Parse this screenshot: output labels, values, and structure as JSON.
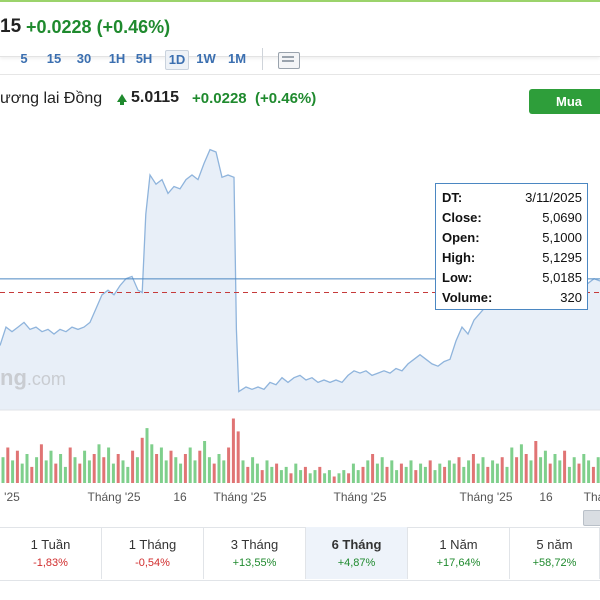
{
  "header": {
    "price_fragment": "15",
    "change": "+0.0228 (+0.46%)"
  },
  "toolbar": {
    "timeframes": [
      "5",
      "15",
      "30",
      "1H",
      "5H",
      "1D",
      "1W",
      "1M"
    ],
    "active": "1D"
  },
  "chart_header": {
    "name": "ương lai Đồng",
    "price": "5.0115",
    "change": "+0.0228",
    "change_pct": "(+0.46%)",
    "buy_label": "Mua"
  },
  "tooltip": {
    "rows": [
      {
        "key": "DT:",
        "value": "3/11/2025"
      },
      {
        "key": "Close:",
        "value": "5,0690"
      },
      {
        "key": "Open:",
        "value": "5,1000"
      },
      {
        "key": "High:",
        "value": "5,1295"
      },
      {
        "key": "Low:",
        "value": "5,0185"
      },
      {
        "key": "Volume:",
        "value": "320"
      }
    ]
  },
  "watermark": {
    "text": "ng",
    "suffix": ".com"
  },
  "colors": {
    "line": "#8fb4dc",
    "area": "#e8eff8",
    "up_volume": "#7fcf8c",
    "down_volume": "#e07474",
    "accent_green": "#1f8a2e",
    "negative_red": "#d12d2d",
    "crosshair": "#4b87c2",
    "reference_dashed": "#c63a3a"
  },
  "chart_data": {
    "type": "area",
    "title": "",
    "xlabel": "",
    "ylabel": "",
    "x_tick_labels": [
      "'25",
      "Tháng '25",
      "16",
      "Tháng '25",
      "Tháng '25",
      "Tháng '25",
      "16",
      "Thá"
    ],
    "x_tick_positions": [
      0.02,
      0.19,
      0.3,
      0.4,
      0.6,
      0.81,
      0.91,
      0.99
    ],
    "price_series": [
      {
        "x": 0.0,
        "y": 4.78
      },
      {
        "x": 0.01,
        "y": 4.86
      },
      {
        "x": 0.02,
        "y": 4.84
      },
      {
        "x": 0.03,
        "y": 4.86
      },
      {
        "x": 0.04,
        "y": 4.88
      },
      {
        "x": 0.05,
        "y": 4.85
      },
      {
        "x": 0.06,
        "y": 4.86
      },
      {
        "x": 0.07,
        "y": 4.84
      },
      {
        "x": 0.08,
        "y": 4.85
      },
      {
        "x": 0.09,
        "y": 4.83
      },
      {
        "x": 0.1,
        "y": 4.85
      },
      {
        "x": 0.11,
        "y": 4.84
      },
      {
        "x": 0.12,
        "y": 4.86
      },
      {
        "x": 0.13,
        "y": 4.85
      },
      {
        "x": 0.14,
        "y": 4.86
      },
      {
        "x": 0.15,
        "y": 4.88
      },
      {
        "x": 0.16,
        "y": 4.94
      },
      {
        "x": 0.17,
        "y": 5.0
      },
      {
        "x": 0.18,
        "y": 5.02
      },
      {
        "x": 0.19,
        "y": 5.0
      },
      {
        "x": 0.2,
        "y": 5.04
      },
      {
        "x": 0.21,
        "y": 5.07
      },
      {
        "x": 0.22,
        "y": 5.08
      },
      {
        "x": 0.23,
        "y": 5.02
      },
      {
        "x": 0.237,
        "y": 5.01
      },
      {
        "x": 0.243,
        "y": 5.35
      },
      {
        "x": 0.25,
        "y": 5.52
      },
      {
        "x": 0.26,
        "y": 5.48
      },
      {
        "x": 0.27,
        "y": 5.5
      },
      {
        "x": 0.28,
        "y": 5.44
      },
      {
        "x": 0.29,
        "y": 5.47
      },
      {
        "x": 0.3,
        "y": 5.46
      },
      {
        "x": 0.31,
        "y": 5.5
      },
      {
        "x": 0.32,
        "y": 5.52
      },
      {
        "x": 0.33,
        "y": 5.5
      },
      {
        "x": 0.34,
        "y": 5.57
      },
      {
        "x": 0.35,
        "y": 5.63
      },
      {
        "x": 0.36,
        "y": 5.62
      },
      {
        "x": 0.37,
        "y": 5.51
      },
      {
        "x": 0.38,
        "y": 5.52
      },
      {
        "x": 0.39,
        "y": 5.51
      },
      {
        "x": 0.394,
        "y": 4.85
      },
      {
        "x": 0.398,
        "y": 4.58
      },
      {
        "x": 0.41,
        "y": 4.6
      },
      {
        "x": 0.42,
        "y": 4.59
      },
      {
        "x": 0.43,
        "y": 4.6
      },
      {
        "x": 0.44,
        "y": 4.59
      },
      {
        "x": 0.45,
        "y": 4.62
      },
      {
        "x": 0.46,
        "y": 4.61
      },
      {
        "x": 0.47,
        "y": 4.64
      },
      {
        "x": 0.48,
        "y": 4.62
      },
      {
        "x": 0.49,
        "y": 4.64
      },
      {
        "x": 0.5,
        "y": 4.65
      },
      {
        "x": 0.51,
        "y": 4.63
      },
      {
        "x": 0.52,
        "y": 4.64
      },
      {
        "x": 0.53,
        "y": 4.62
      },
      {
        "x": 0.54,
        "y": 4.63
      },
      {
        "x": 0.55,
        "y": 4.62
      },
      {
        "x": 0.56,
        "y": 4.63
      },
      {
        "x": 0.57,
        "y": 4.62
      },
      {
        "x": 0.58,
        "y": 4.65
      },
      {
        "x": 0.59,
        "y": 4.67
      },
      {
        "x": 0.6,
        "y": 4.66
      },
      {
        "x": 0.61,
        "y": 4.67
      },
      {
        "x": 0.62,
        "y": 4.65
      },
      {
        "x": 0.63,
        "y": 4.66
      },
      {
        "x": 0.64,
        "y": 4.67
      },
      {
        "x": 0.65,
        "y": 4.66
      },
      {
        "x": 0.66,
        "y": 4.68
      },
      {
        "x": 0.67,
        "y": 4.67
      },
      {
        "x": 0.68,
        "y": 4.7
      },
      {
        "x": 0.69,
        "y": 4.72
      },
      {
        "x": 0.7,
        "y": 4.74
      },
      {
        "x": 0.71,
        "y": 4.72
      },
      {
        "x": 0.72,
        "y": 4.7
      },
      {
        "x": 0.73,
        "y": 4.69
      },
      {
        "x": 0.74,
        "y": 4.71
      },
      {
        "x": 0.75,
        "y": 4.72
      },
      {
        "x": 0.76,
        "y": 4.8
      },
      {
        "x": 0.77,
        "y": 4.86
      },
      {
        "x": 0.78,
        "y": 4.83
      },
      {
        "x": 0.79,
        "y": 4.89
      },
      {
        "x": 0.8,
        "y": 4.92
      },
      {
        "x": 0.81,
        "y": 4.95
      },
      {
        "x": 0.82,
        "y": 4.98
      },
      {
        "x": 0.83,
        "y": 5.0
      },
      {
        "x": 0.84,
        "y": 5.01
      },
      {
        "x": 0.85,
        "y": 4.99
      },
      {
        "x": 0.86,
        "y": 5.02
      },
      {
        "x": 0.87,
        "y": 5.01
      },
      {
        "x": 0.88,
        "y": 5.03
      },
      {
        "x": 0.89,
        "y": 5.05
      },
      {
        "x": 0.9,
        "y": 5.04
      },
      {
        "x": 0.91,
        "y": 5.06
      },
      {
        "x": 0.92,
        "y": 5.05
      },
      {
        "x": 0.93,
        "y": 5.07
      },
      {
        "x": 0.94,
        "y": 5.06
      },
      {
        "x": 0.95,
        "y": 5.05
      },
      {
        "x": 0.96,
        "y": 5.04
      },
      {
        "x": 0.97,
        "y": 5.03
      },
      {
        "x": 0.98,
        "y": 5.05
      },
      {
        "x": 0.99,
        "y": 5.07
      },
      {
        "x": 1.0,
        "y": 5.06
      }
    ],
    "price_range": [
      4.5,
      5.75
    ],
    "crosshair_price": 5.069,
    "reference_price": 5.01,
    "volume_series": [
      {
        "x": 0.005,
        "v": 40,
        "up": true
      },
      {
        "x": 0.013,
        "v": 55,
        "up": false
      },
      {
        "x": 0.021,
        "v": 35,
        "up": true
      },
      {
        "x": 0.029,
        "v": 50,
        "up": false
      },
      {
        "x": 0.037,
        "v": 30,
        "up": true
      },
      {
        "x": 0.045,
        "v": 45,
        "up": true
      },
      {
        "x": 0.053,
        "v": 25,
        "up": false
      },
      {
        "x": 0.061,
        "v": 40,
        "up": true
      },
      {
        "x": 0.069,
        "v": 60,
        "up": false
      },
      {
        "x": 0.077,
        "v": 35,
        "up": true
      },
      {
        "x": 0.085,
        "v": 50,
        "up": true
      },
      {
        "x": 0.093,
        "v": 30,
        "up": false
      },
      {
        "x": 0.101,
        "v": 45,
        "up": true
      },
      {
        "x": 0.109,
        "v": 25,
        "up": true
      },
      {
        "x": 0.117,
        "v": 55,
        "up": false
      },
      {
        "x": 0.125,
        "v": 40,
        "up": true
      },
      {
        "x": 0.133,
        "v": 30,
        "up": false
      },
      {
        "x": 0.141,
        "v": 50,
        "up": true
      },
      {
        "x": 0.149,
        "v": 35,
        "up": true
      },
      {
        "x": 0.157,
        "v": 45,
        "up": false
      },
      {
        "x": 0.165,
        "v": 60,
        "up": true
      },
      {
        "x": 0.173,
        "v": 40,
        "up": false
      },
      {
        "x": 0.181,
        "v": 55,
        "up": true
      },
      {
        "x": 0.189,
        "v": 30,
        "up": true
      },
      {
        "x": 0.197,
        "v": 45,
        "up": false
      },
      {
        "x": 0.205,
        "v": 35,
        "up": true
      },
      {
        "x": 0.213,
        "v": 25,
        "up": true
      },
      {
        "x": 0.221,
        "v": 50,
        "up": false
      },
      {
        "x": 0.229,
        "v": 40,
        "up": true
      },
      {
        "x": 0.237,
        "v": 70,
        "up": false
      },
      {
        "x": 0.245,
        "v": 85,
        "up": true
      },
      {
        "x": 0.253,
        "v": 60,
        "up": true
      },
      {
        "x": 0.261,
        "v": 45,
        "up": false
      },
      {
        "x": 0.269,
        "v": 55,
        "up": true
      },
      {
        "x": 0.277,
        "v": 35,
        "up": true
      },
      {
        "x": 0.285,
        "v": 50,
        "up": false
      },
      {
        "x": 0.293,
        "v": 40,
        "up": true
      },
      {
        "x": 0.301,
        "v": 30,
        "up": true
      },
      {
        "x": 0.309,
        "v": 45,
        "up": false
      },
      {
        "x": 0.317,
        "v": 55,
        "up": true
      },
      {
        "x": 0.325,
        "v": 35,
        "up": true
      },
      {
        "x": 0.333,
        "v": 50,
        "up": false
      },
      {
        "x": 0.341,
        "v": 65,
        "up": true
      },
      {
        "x": 0.349,
        "v": 40,
        "up": true
      },
      {
        "x": 0.357,
        "v": 30,
        "up": false
      },
      {
        "x": 0.365,
        "v": 45,
        "up": true
      },
      {
        "x": 0.373,
        "v": 35,
        "up": true
      },
      {
        "x": 0.381,
        "v": 55,
        "up": false
      },
      {
        "x": 0.389,
        "v": 100,
        "up": false
      },
      {
        "x": 0.397,
        "v": 80,
        "up": false
      },
      {
        "x": 0.405,
        "v": 35,
        "up": true
      },
      {
        "x": 0.413,
        "v": 25,
        "up": false
      },
      {
        "x": 0.421,
        "v": 40,
        "up": true
      },
      {
        "x": 0.429,
        "v": 30,
        "up": true
      },
      {
        "x": 0.437,
        "v": 20,
        "up": false
      },
      {
        "x": 0.445,
        "v": 35,
        "up": true
      },
      {
        "x": 0.453,
        "v": 25,
        "up": true
      },
      {
        "x": 0.461,
        "v": 30,
        "up": false
      },
      {
        "x": 0.469,
        "v": 20,
        "up": true
      },
      {
        "x": 0.477,
        "v": 25,
        "up": true
      },
      {
        "x": 0.485,
        "v": 15,
        "up": false
      },
      {
        "x": 0.493,
        "v": 30,
        "up": true
      },
      {
        "x": 0.501,
        "v": 20,
        "up": true
      },
      {
        "x": 0.509,
        "v": 25,
        "up": false
      },
      {
        "x": 0.517,
        "v": 15,
        "up": true
      },
      {
        "x": 0.525,
        "v": 20,
        "up": true
      },
      {
        "x": 0.533,
        "v": 25,
        "up": false
      },
      {
        "x": 0.541,
        "v": 15,
        "up": true
      },
      {
        "x": 0.549,
        "v": 20,
        "up": true
      },
      {
        "x": 0.557,
        "v": 10,
        "up": false
      },
      {
        "x": 0.565,
        "v": 15,
        "up": true
      },
      {
        "x": 0.573,
        "v": 20,
        "up": true
      },
      {
        "x": 0.581,
        "v": 15,
        "up": false
      },
      {
        "x": 0.589,
        "v": 30,
        "up": true
      },
      {
        "x": 0.597,
        "v": 20,
        "up": true
      },
      {
        "x": 0.605,
        "v": 25,
        "up": false
      },
      {
        "x": 0.613,
        "v": 35,
        "up": true
      },
      {
        "x": 0.621,
        "v": 45,
        "up": false
      },
      {
        "x": 0.629,
        "v": 30,
        "up": true
      },
      {
        "x": 0.637,
        "v": 40,
        "up": true
      },
      {
        "x": 0.645,
        "v": 25,
        "up": false
      },
      {
        "x": 0.653,
        "v": 35,
        "up": true
      },
      {
        "x": 0.661,
        "v": 20,
        "up": true
      },
      {
        "x": 0.669,
        "v": 30,
        "up": false
      },
      {
        "x": 0.677,
        "v": 25,
        "up": true
      },
      {
        "x": 0.685,
        "v": 35,
        "up": true
      },
      {
        "x": 0.693,
        "v": 20,
        "up": false
      },
      {
        "x": 0.701,
        "v": 30,
        "up": true
      },
      {
        "x": 0.709,
        "v": 25,
        "up": true
      },
      {
        "x": 0.717,
        "v": 35,
        "up": false
      },
      {
        "x": 0.725,
        "v": 20,
        "up": true
      },
      {
        "x": 0.733,
        "v": 30,
        "up": true
      },
      {
        "x": 0.741,
        "v": 25,
        "up": false
      },
      {
        "x": 0.749,
        "v": 35,
        "up": true
      },
      {
        "x": 0.757,
        "v": 30,
        "up": true
      },
      {
        "x": 0.765,
        "v": 40,
        "up": false
      },
      {
        "x": 0.773,
        "v": 25,
        "up": true
      },
      {
        "x": 0.781,
        "v": 35,
        "up": true
      },
      {
        "x": 0.789,
        "v": 45,
        "up": false
      },
      {
        "x": 0.797,
        "v": 30,
        "up": true
      },
      {
        "x": 0.805,
        "v": 40,
        "up": true
      },
      {
        "x": 0.813,
        "v": 25,
        "up": false
      },
      {
        "x": 0.821,
        "v": 35,
        "up": true
      },
      {
        "x": 0.829,
        "v": 30,
        "up": true
      },
      {
        "x": 0.837,
        "v": 40,
        "up": false
      },
      {
        "x": 0.845,
        "v": 25,
        "up": true
      },
      {
        "x": 0.853,
        "v": 55,
        "up": true
      },
      {
        "x": 0.861,
        "v": 40,
        "up": false
      },
      {
        "x": 0.869,
        "v": 60,
        "up": true
      },
      {
        "x": 0.877,
        "v": 45,
        "up": false
      },
      {
        "x": 0.885,
        "v": 35,
        "up": true
      },
      {
        "x": 0.893,
        "v": 65,
        "up": false
      },
      {
        "x": 0.901,
        "v": 40,
        "up": true
      },
      {
        "x": 0.909,
        "v": 50,
        "up": true
      },
      {
        "x": 0.917,
        "v": 30,
        "up": false
      },
      {
        "x": 0.925,
        "v": 45,
        "up": true
      },
      {
        "x": 0.933,
        "v": 35,
        "up": true
      },
      {
        "x": 0.941,
        "v": 50,
        "up": false
      },
      {
        "x": 0.949,
        "v": 25,
        "up": true
      },
      {
        "x": 0.957,
        "v": 40,
        "up": true
      },
      {
        "x": 0.965,
        "v": 30,
        "up": false
      },
      {
        "x": 0.973,
        "v": 45,
        "up": true
      },
      {
        "x": 0.981,
        "v": 35,
        "up": true
      },
      {
        "x": 0.989,
        "v": 25,
        "up": false
      },
      {
        "x": 0.997,
        "v": 40,
        "up": true
      }
    ],
    "grid": false,
    "legend": "none"
  },
  "periods": [
    {
      "label": "1 Tuần",
      "value": "-1,83%",
      "sign": "neg"
    },
    {
      "label": "1 Tháng",
      "value": "-0,54%",
      "sign": "neg"
    },
    {
      "label": "3 Tháng",
      "value": "+13,55%",
      "sign": "pos"
    },
    {
      "label": "6 Tháng",
      "value": "+4,87%",
      "sign": "pos",
      "active": true
    },
    {
      "label": "1 Năm",
      "value": "+17,64%",
      "sign": "pos"
    },
    {
      "label": "5 năm",
      "value": "+58,72%",
      "sign": "pos"
    }
  ]
}
